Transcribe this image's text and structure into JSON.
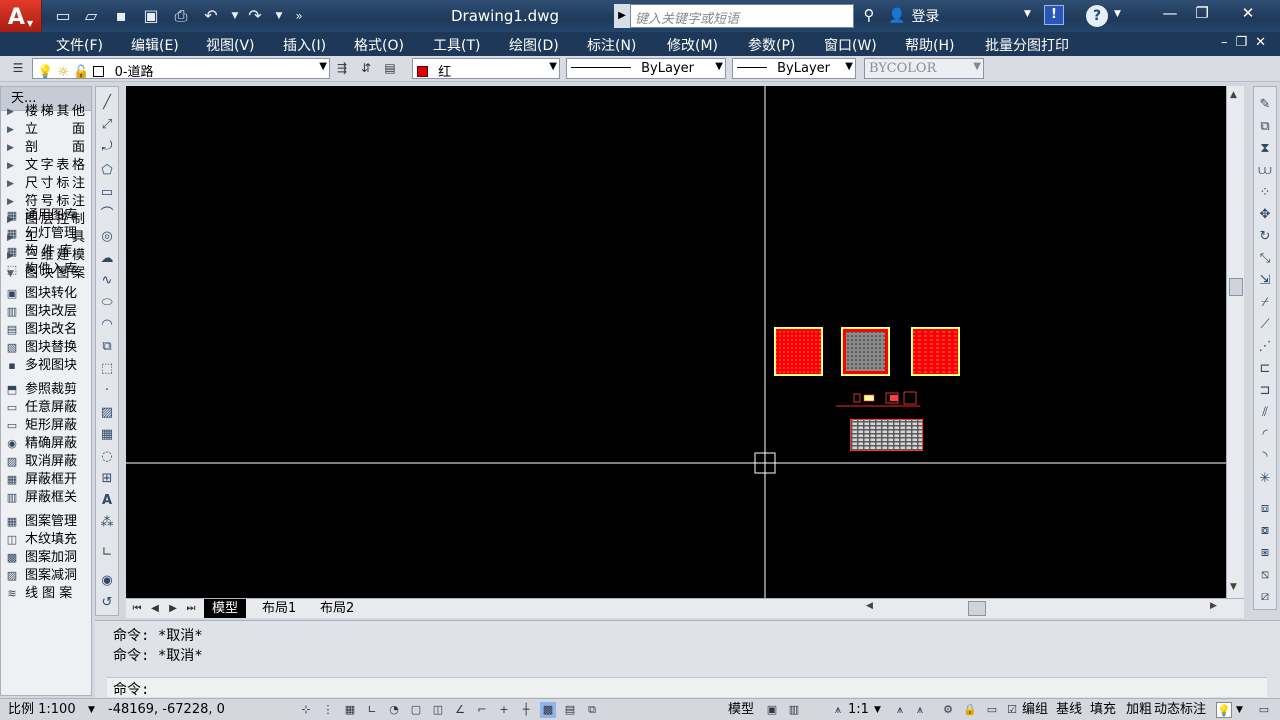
{
  "titlebar": {
    "doc_title": "Drawing1.dwg",
    "search_placeholder": "键入关键字或短语",
    "login": "登录"
  },
  "menus": [
    "文件(F)",
    "编辑(E)",
    "视图(V)",
    "插入(I)",
    "格式(O)",
    "工具(T)",
    "绘图(D)",
    "标注(N)",
    "修改(M)",
    "参数(P)",
    "窗口(W)",
    "帮助(H)",
    "批量分图打印"
  ],
  "properties": {
    "layer": "0-道路",
    "color": "红",
    "color_hex": "#e00000",
    "linetype": "ByLayer",
    "lineweight": "ByLayer",
    "plotstyle": "BYCOLOR"
  },
  "palette": {
    "title": "天...",
    "categories": [
      "楼梯其他",
      "立　面",
      "剖　面",
      "文字表格",
      "尺寸标注",
      "符号标注",
      "图层控制",
      "工　具",
      "三维建模",
      "图块图案"
    ],
    "tools": [
      "通用图库",
      "幻灯管理",
      "构 件 库",
      "构件入库",
      "图块转化",
      "图块改层",
      "图块改名",
      "图块替换",
      "多视图块",
      "参照裁剪",
      "任意屏蔽",
      "矩形屏蔽",
      "精确屏蔽",
      "取消屏蔽",
      "屏蔽框开",
      "屏蔽框关",
      "图案管理",
      "木纹填充",
      "图案加洞",
      "图案减洞",
      "线 图 案"
    ]
  },
  "tabs": [
    "模型",
    "布局1",
    "布局2"
  ],
  "command": {
    "history": [
      "命令: *取消*",
      "命令: *取消*"
    ],
    "prompt": "命令:"
  },
  "status": {
    "scale": "比例 1:100",
    "coords": "-48169, -67228, 0",
    "model": "模型",
    "annot_scale": "1:1",
    "toggles": [
      "编组",
      "基线",
      "填充",
      "加粗",
      "动态标注"
    ]
  },
  "colors": {
    "canvas_bg": "#000000",
    "block_red": "#ff0000",
    "block_border": "#ffff80"
  }
}
